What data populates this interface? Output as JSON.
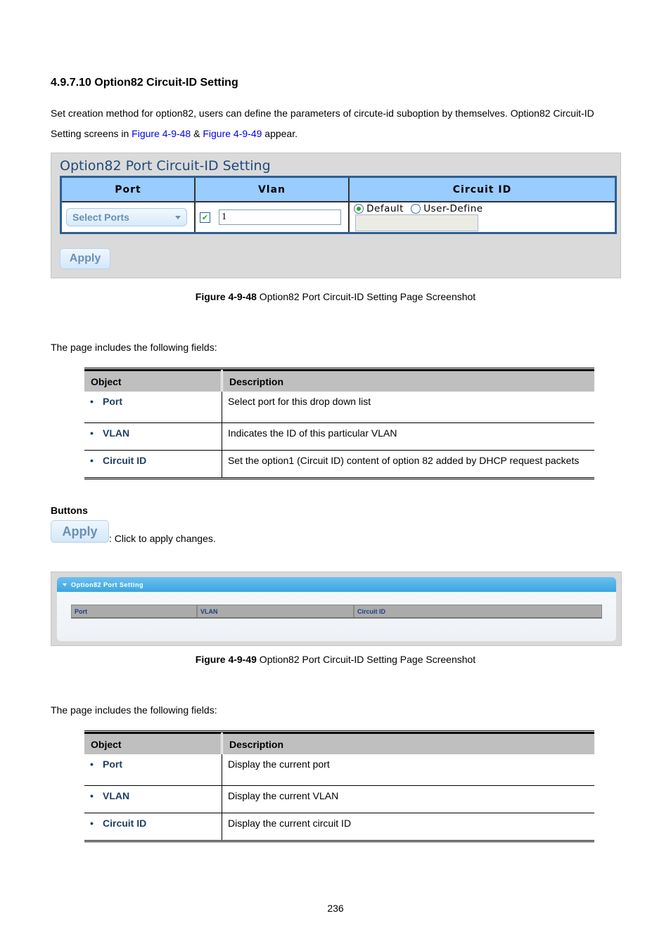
{
  "section": {
    "heading": "4.9.7.10 Option82 Circuit-ID Setting",
    "intro_line1": "Set creation method for option82, users can define the parameters of circute-id suboption by themselves. Option82 Circuit-ID",
    "intro_line2_pre": "Setting screens in ",
    "intro_link1": "Figure 4-9-48",
    "intro_amp": " & ",
    "intro_link2": "Figure 4-9-49",
    "intro_line2_post": " appear."
  },
  "figure1": {
    "title": "Option82 Port Circuit-ID Setting",
    "headers": [
      "Port",
      "Vlan",
      "Circuit ID"
    ],
    "select_ports_label": "Select Ports",
    "vlan_checked": true,
    "vlan_value": "1",
    "radio_default_label": "Default",
    "radio_user_define_label": "User-Define",
    "selected_radio": "Default",
    "user_define_value": "",
    "apply_label": "Apply",
    "caption_bold": "Figure 4-9-48",
    "caption_text": " Option82 Port Circuit-ID Setting Page Screenshot"
  },
  "fields_intro_1": "The page includes the following fields:",
  "table1": {
    "headers": [
      "Object",
      "Description"
    ],
    "rows": [
      {
        "object": "Port",
        "description": "Select port for this drop down list"
      },
      {
        "object": "VLAN",
        "description": "Indicates the ID of this particular VLAN"
      },
      {
        "object": "Circuit ID",
        "description": "Set the option1 (Circuit ID) content of option 82 added by DHCP request packets"
      }
    ]
  },
  "buttons": {
    "heading": "Buttons",
    "apply_label": "Apply",
    "apply_desc": ": Click to apply changes."
  },
  "figure2": {
    "panel_title": "Option82 Port Setting",
    "headers": [
      "Port",
      "VLAN",
      "Circuit ID"
    ],
    "caption_bold": "Figure 4-9-49",
    "caption_text": " Option82 Port Circuit-ID Setting Page Screenshot"
  },
  "fields_intro_2": "The page includes the following fields:",
  "table2": {
    "headers": [
      "Object",
      "Description"
    ],
    "rows": [
      {
        "object": "Port",
        "description": "Display the current port"
      },
      {
        "object": "VLAN",
        "description": "Display the current VLAN"
      },
      {
        "object": "Circuit ID",
        "description": "Display the current circuit ID"
      }
    ]
  },
  "page_number": "236"
}
